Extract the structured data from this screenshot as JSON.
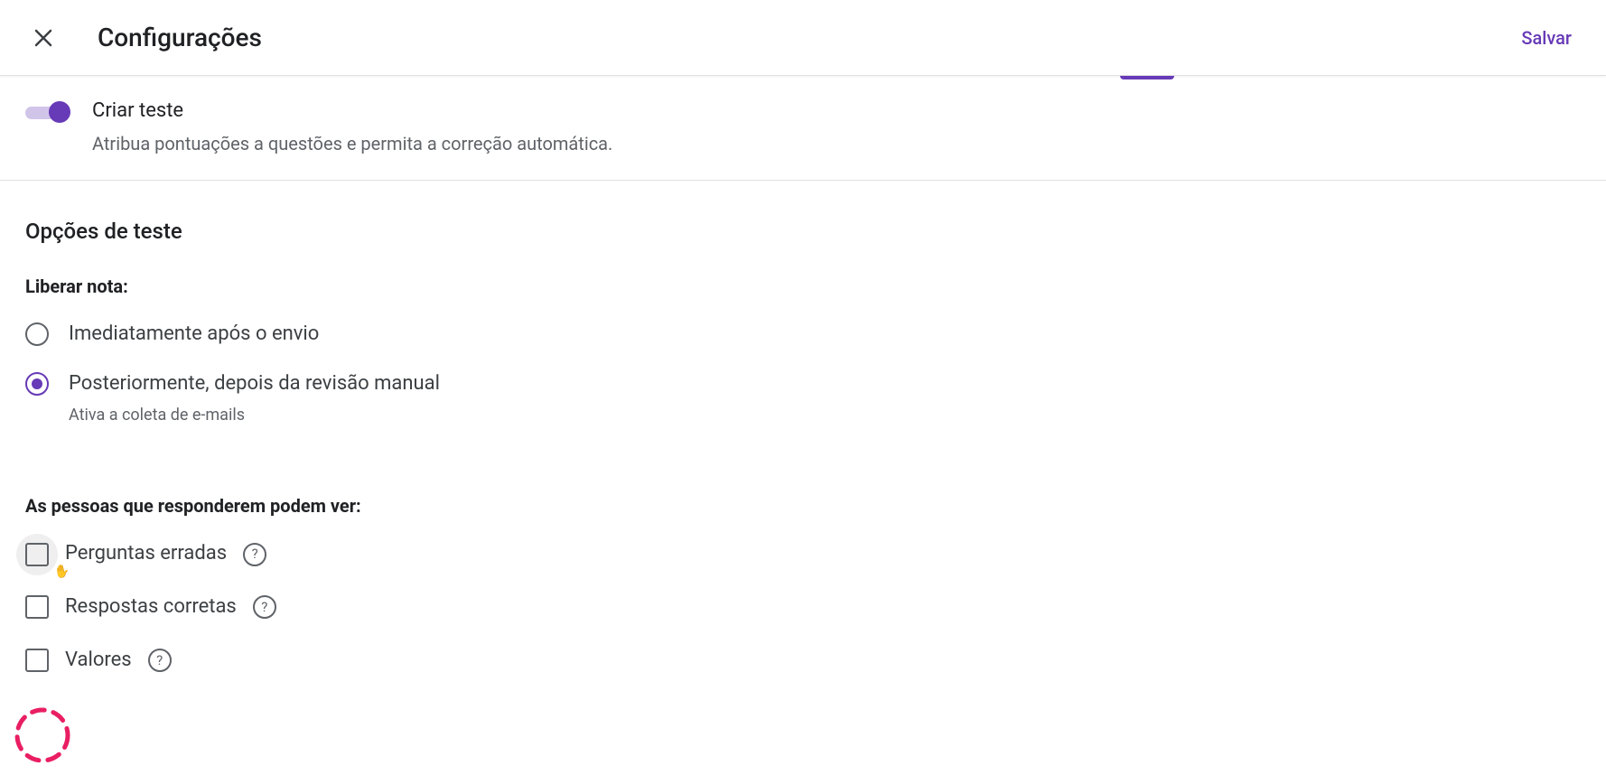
{
  "header": {
    "title": "Configurações",
    "save_label": "Salvar"
  },
  "quiz": {
    "toggle_on": true,
    "title": "Criar teste",
    "subtitle": "Atribua pontuações a questões e permita a correção automática."
  },
  "options": {
    "heading": "Opções de teste",
    "release_grade_heading": "Liberar nota:",
    "release_choices": [
      {
        "label": "Imediatamente após o envio",
        "selected": false,
        "sub": null
      },
      {
        "label": "Posteriormente, depois da revisão manual",
        "selected": true,
        "sub": "Ativa a coleta de e-mails"
      }
    ],
    "respondent_heading": "As pessoas que responderem podem ver:",
    "respondent_options": [
      {
        "label": "Perguntas erradas",
        "checked": false
      },
      {
        "label": "Respostas corretas",
        "checked": false
      },
      {
        "label": "Valores",
        "checked": false
      }
    ]
  },
  "colors": {
    "accent": "#673ab7",
    "annotation": "#e91e63"
  }
}
